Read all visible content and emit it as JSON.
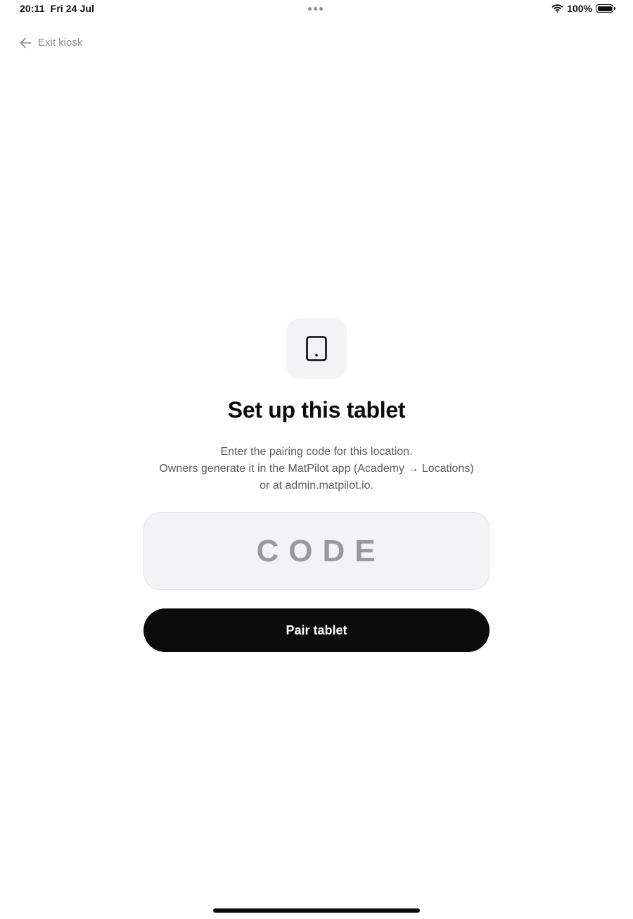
{
  "status_bar": {
    "time": "20:11",
    "date": "Fri 24 Jul",
    "battery_percent": "100%",
    "battery_level": 1.0
  },
  "header": {
    "exit_label": "Exit kiosk",
    "exit_icon": "arrow-left-icon"
  },
  "setup": {
    "icon": "tablet-icon",
    "title": "Set up this tablet",
    "description_lines": [
      "Enter the pairing code for this location.",
      "Owners generate it in the MatPilot app (Academy → Locations)",
      "or at admin.matpilot.io."
    ],
    "code_input": {
      "placeholder": "CODE",
      "value": ""
    },
    "pair_button_label": "Pair tablet"
  },
  "colors": {
    "primary": "#0b0b0c",
    "muted_text": "#8e8e93",
    "body_text": "#5b5b60",
    "input_bg": "#f3f3f5",
    "placeholder": "#9a9a9e"
  }
}
